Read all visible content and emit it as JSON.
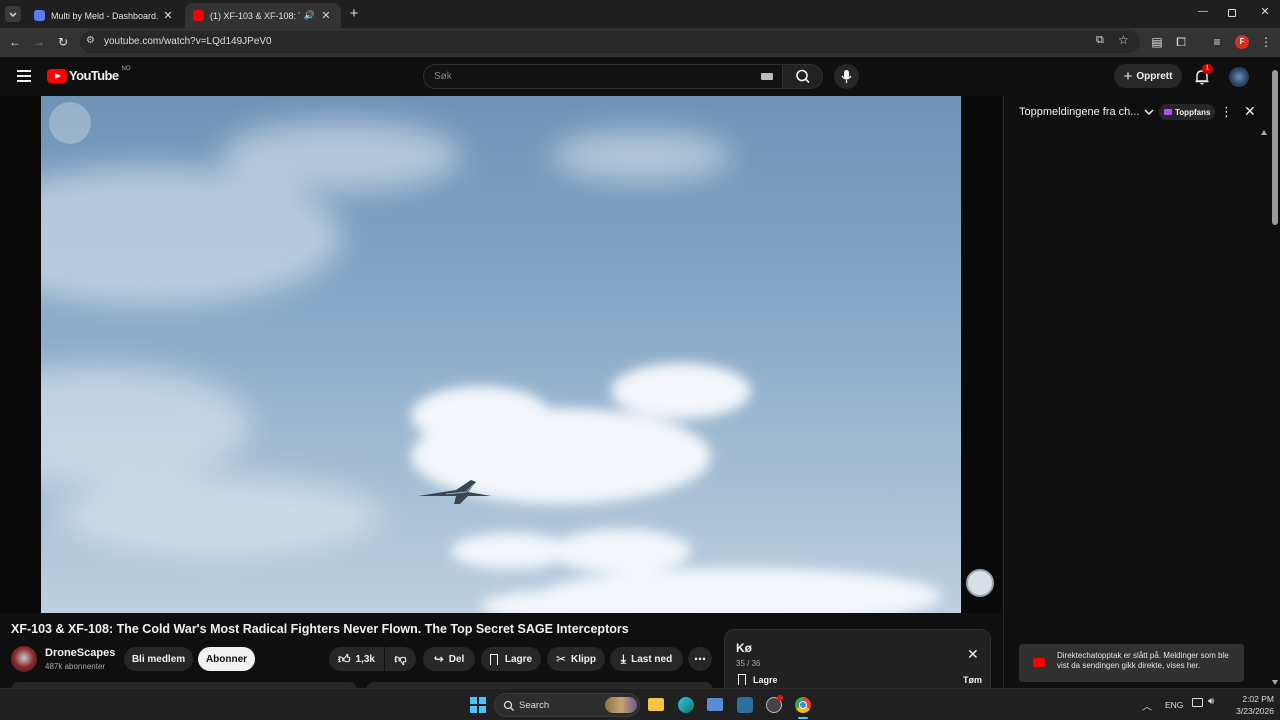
{
  "browser": {
    "tabs": [
      {
        "title": "Multi by Meld - Dashboard.",
        "active": false
      },
      {
        "title": "(1) XF-103 & XF-108: The C",
        "active": true
      }
    ],
    "url": "youtube.com/watch?v=LQd149JPeV0",
    "profile_letter": "F"
  },
  "youtube": {
    "logo_text": "YouTube",
    "region": "NO",
    "search_placeholder": "Søk",
    "create_label": "Opprett",
    "notification_count": "1"
  },
  "video": {
    "title": "XF-103 & XF-108: The Cold War's Most Radical Fighters Never Flown. The Top Secret SAGE Interceptors",
    "channel_name": "DroneScapes",
    "subscribers": "487k abonnenter",
    "join_label": "Bli medlem",
    "subscribe_label": "Abonner",
    "like_count": "1,3k",
    "share_label": "Del",
    "save_label": "Lagre",
    "clip_label": "Klipp",
    "download_label": "Last ned"
  },
  "chat": {
    "header_title": "Toppmeldingene fra ch...",
    "topfans_label": "Toppfans",
    "notice": "Direktechatopptak er slått på. Meldinger som ble vist da sendingen gikk direkte, vises her."
  },
  "queue": {
    "title": "Kø",
    "position": "35 / 36",
    "save_label": "Lagre",
    "clear_label": "Tøm"
  },
  "taskbar": {
    "search_label": "Search",
    "language": "ENG",
    "time": "2:02 PM",
    "date": "3/23/2026"
  },
  "colors": {
    "youtube_red": "#ff0000",
    "background": "#0f0f0f",
    "surface": "#272727",
    "accent_blue": "#3ea6ff"
  }
}
